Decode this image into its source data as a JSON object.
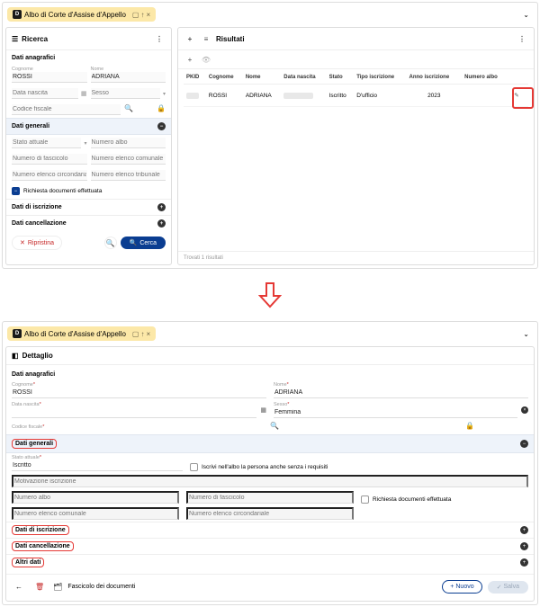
{
  "tab_title": "Albo di Corte d'Assise d'Appello",
  "search": {
    "title": "Ricerca",
    "section_anag": "Dati anagrafici",
    "cognome_label": "Cognome",
    "cognome_value": "ROSSI",
    "nome_label": "Nome",
    "nome_value": "ADRIANA",
    "data_nascita_ph": "Data nascita",
    "sesso_ph": "Sesso",
    "codice_fiscale_ph": "Codice fiscale",
    "section_gen": "Dati generali",
    "stato_attuale_ph": "Stato attuale",
    "numero_albo_ph": "Numero albo",
    "numero_fascicolo_ph": "Numero di fascicolo",
    "numero_elenco_comunale_ph": "Numero elenco comunale",
    "numero_elenco_circ_ph": "Numero elenco circondariale",
    "numero_elenco_trib_ph": "Numero elenco tribunale",
    "richiesta_doc_label": "Richiesta documenti effettuata",
    "section_iscr": "Dati di iscrizione",
    "section_canc": "Dati cancellazione",
    "btn_reset": "Ripristina",
    "btn_search": "Cerca"
  },
  "results": {
    "title": "Risultati",
    "headers": {
      "pkid": "PKID",
      "cognome": "Cognome",
      "nome": "Nome",
      "data_nascita": "Data nascita",
      "stato": "Stato",
      "tipo_iscrizione": "Tipo iscrizione",
      "anno_iscrizione": "Anno iscrizione",
      "numero_albo": "Numero albo"
    },
    "row": {
      "cognome": "ROSSI",
      "nome": "ADRIANA",
      "stato": "Iscritto",
      "tipo_iscrizione": "D'ufficio",
      "anno_iscrizione": "2023"
    },
    "count_label": "Trovati 1 risultati"
  },
  "detail": {
    "title": "Dettaglio",
    "section_anag": "Dati anagrafici",
    "cognome_label": "Cognome",
    "cognome_value": "ROSSI",
    "nome_label": "Nome",
    "nome_value": "ADRIANA",
    "data_nascita_label": "Data nascita",
    "sesso_label": "Sesso",
    "sesso_value": "Femmina",
    "codice_fiscale_label": "Codice fiscale",
    "section_gen": "Dati generali",
    "stato_attuale_label": "Stato attuale",
    "stato_attuale_value": "Iscritto",
    "iscrivi_senza_req_label": "Iscrivi nell'albo la persona anche senza i requisiti",
    "motivazione_ph": "Motivazione iscrizione",
    "numero_albo_ph": "Numero albo",
    "numero_fascicolo_ph": "Numero di fascicolo",
    "richiesta_doc_label": "Richiesta documenti effettuata",
    "numero_elenco_comunale_ph": "Numero elenco comunale",
    "numero_elenco_circ_ph": "Numero elenco circondariale",
    "section_iscr": "Dati di iscrizione",
    "section_canc": "Dati cancellazione",
    "section_altri": "Altri dati",
    "fascicolo_label": "Fascicolo dei documenti",
    "btn_nuovo": "Nuovo",
    "btn_salva": "Salva"
  }
}
